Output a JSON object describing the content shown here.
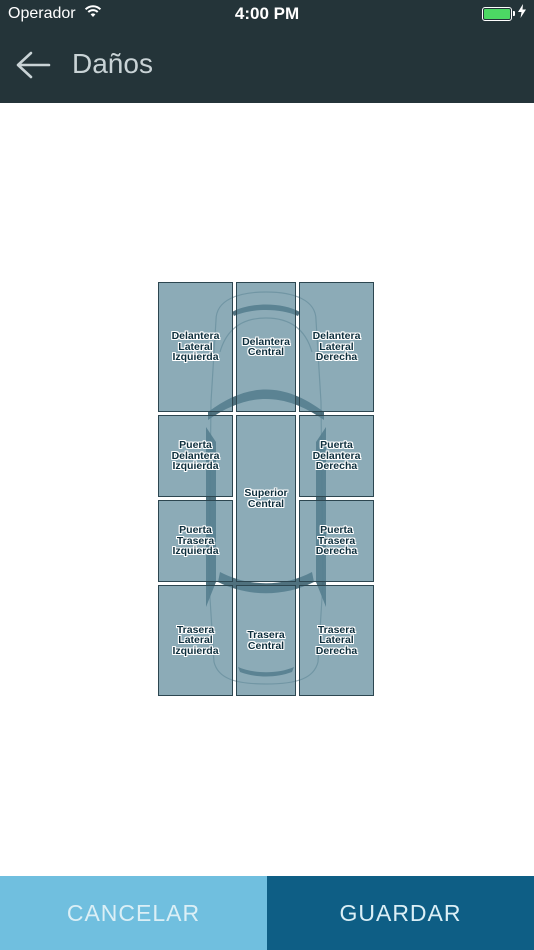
{
  "status_bar": {
    "carrier": "Operador",
    "time": "4:00 PM",
    "battery_color": "#4cd964"
  },
  "header": {
    "title": "Daños",
    "back_icon": "arrow-left-icon",
    "background": "#243439"
  },
  "zones": {
    "front_left": "Delantera\nLateral\nIzquierda",
    "front_center": "Delantera\nCentral",
    "front_right": "Delantera\nLateral\nDerecha",
    "front_door_left": "Puerta\nDelantera\nIzquierda",
    "top_center": "Superior\nCentral",
    "front_door_right": "Puerta\nDelantera\nDerecha",
    "rear_door_left": "Puerta\nTrasera\nIzquierda",
    "rear_door_right": "Puerta\nTrasera\nDerecha",
    "rear_left": "Trasera\nLateral\nIzquierda",
    "rear_center": "Trasera\nCentral",
    "rear_right": "Trasera\nLateral\nDerecha"
  },
  "actions": {
    "cancel_label": "CANCELAR",
    "save_label": "GUARDAR",
    "cancel_color": "#70bfdf",
    "save_color": "#0e5e85"
  }
}
